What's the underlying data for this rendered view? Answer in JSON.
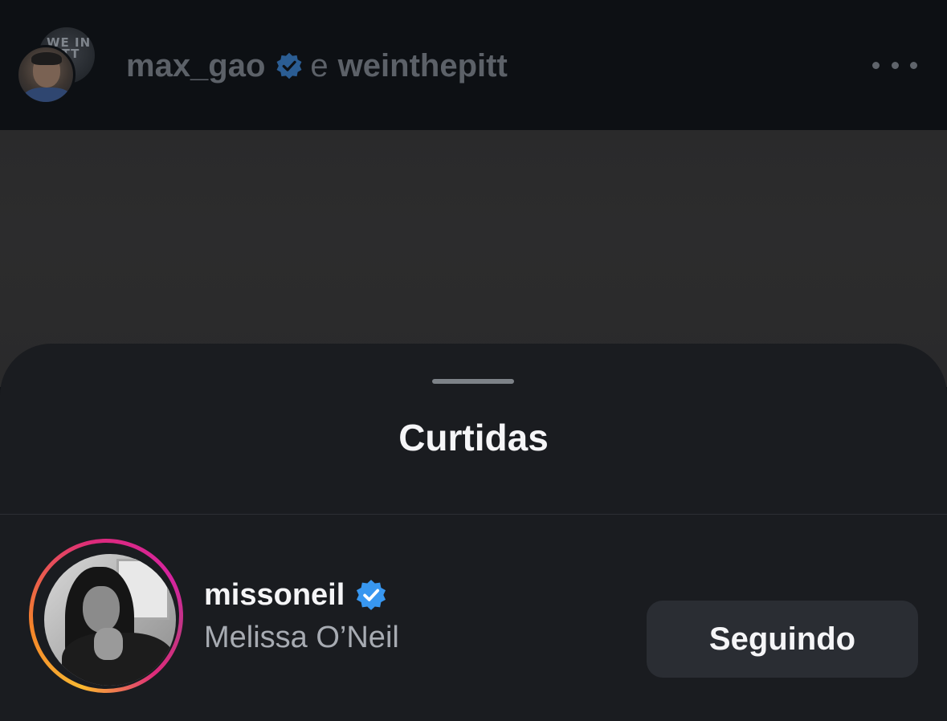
{
  "post_header": {
    "author_primary": "max_gao",
    "conjunction": "e",
    "author_secondary": "weinthepitt",
    "back_avatar_text": "WE IN PITT",
    "more_icon": "more-horizontal-icon"
  },
  "sheet": {
    "title": "Curtidas"
  },
  "likes": [
    {
      "username": "missoneil",
      "full_name": "Melissa O’Neil",
      "verified": true,
      "has_story": true,
      "follow_label": "Seguindo"
    }
  ],
  "colors": {
    "verified_blue": "#3897f0",
    "verified_dim": "#2b5d93",
    "sheet_bg": "#1a1c20",
    "button_bg": "#2a2d33",
    "story_ring": [
      "#f7b733",
      "#f58529",
      "#dd2a7b",
      "#c13584"
    ]
  }
}
